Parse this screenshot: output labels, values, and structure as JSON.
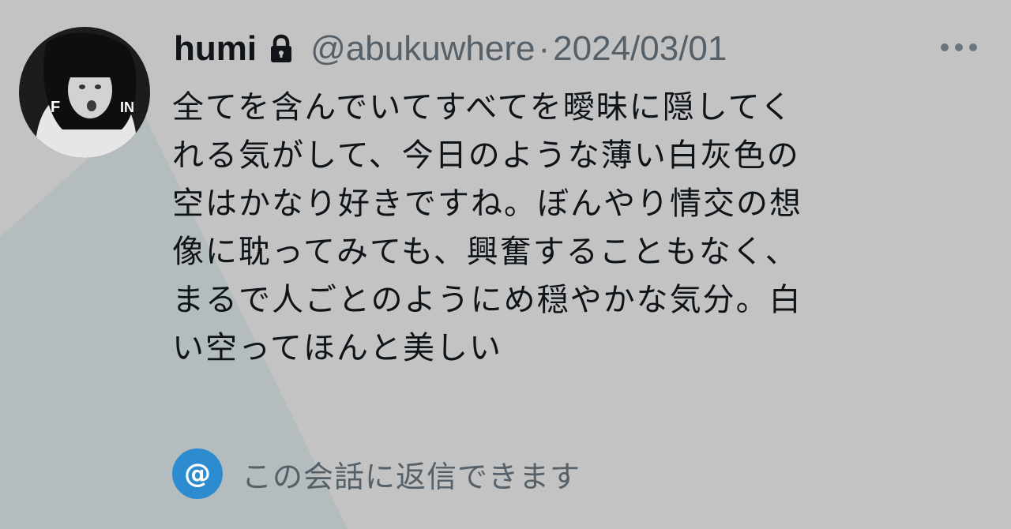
{
  "tweet": {
    "display_name": "humi",
    "handle": "@abukuwhere",
    "separator": "·",
    "timestamp": "2024/03/01",
    "text_lines": [
      "全てを含んでいてすべてを曖昧に隠してく",
      "れる気がして、今日のような薄い白灰色の",
      "空はかなり好きですね。ぼんやり情交の想",
      "像に耽ってみても、興奮することもなく、",
      "まるで人ごとのようにめ穏やかな気分。白",
      "い空ってほんと美しい"
    ],
    "avatar_letters": [
      "F",
      "IN"
    ],
    "reply_setting_icon": "@",
    "reply_setting_label": "この会話に返信できます"
  },
  "icons": {
    "lock": "lock-icon",
    "more": "more-icon",
    "at": "at-icon"
  },
  "colors": {
    "background": "#c3c3c4",
    "background_shape": "#b4bcbd",
    "name_text": "#111418",
    "secondary_text": "#556068",
    "accent_blue": "#2d8bd0"
  }
}
